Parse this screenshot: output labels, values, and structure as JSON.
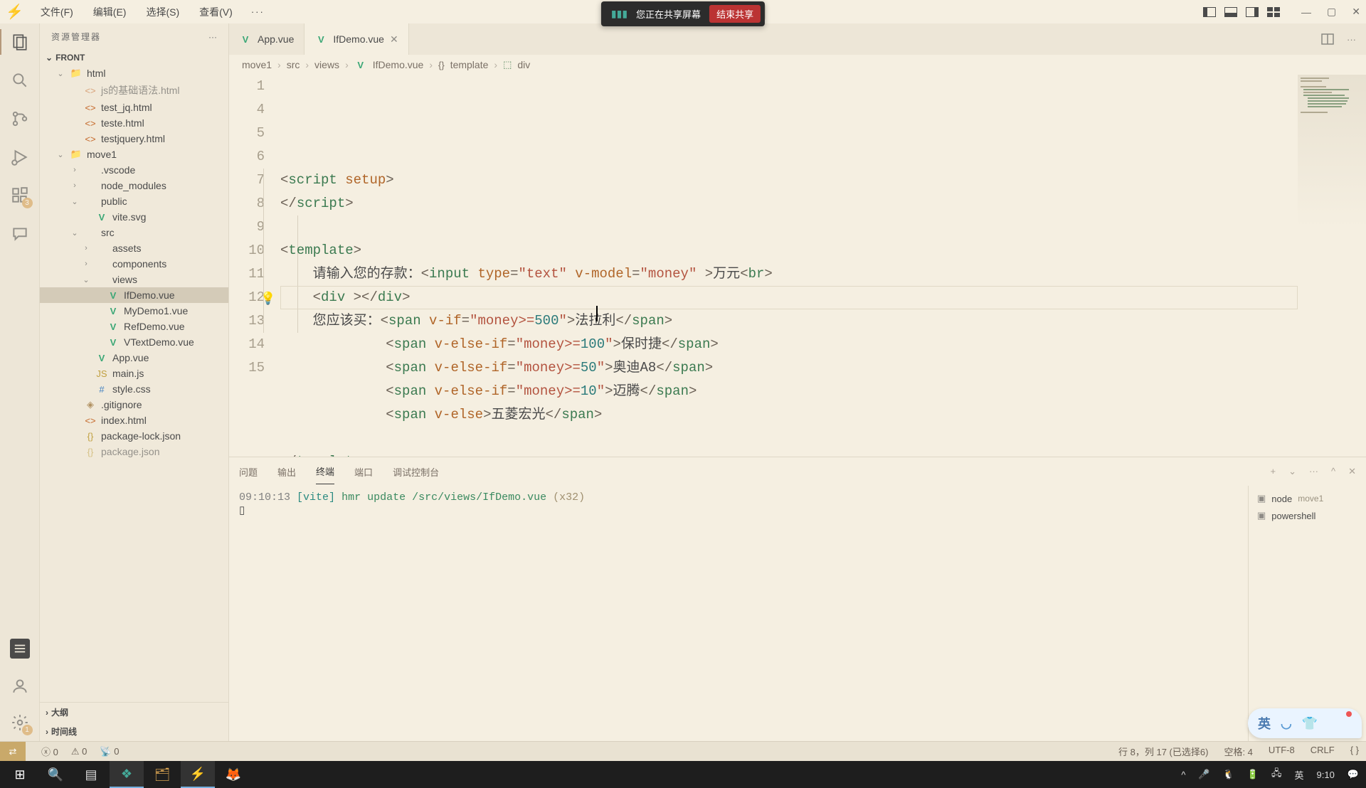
{
  "menu": {
    "file": "文件(F)",
    "edit": "编辑(E)",
    "select": "选择(S)",
    "view": "查看(V)",
    "more": "···"
  },
  "share_banner": {
    "text": "您正在共享屏幕",
    "stop": "结束共享"
  },
  "explorer": {
    "title": "资源管理器",
    "more": "···",
    "project": "FRONT"
  },
  "tree": [
    {
      "pad": 22,
      "chev": "⌄",
      "icon": "📁",
      "cls": "folder",
      "label": "html"
    },
    {
      "pad": 42,
      "icon": "<>",
      "cls": "html",
      "label": "js的基础语法.html",
      "dim": true
    },
    {
      "pad": 42,
      "icon": "<>",
      "cls": "html",
      "label": "test_jq.html"
    },
    {
      "pad": 42,
      "icon": "<>",
      "cls": "html",
      "label": "teste.html"
    },
    {
      "pad": 42,
      "icon": "<>",
      "cls": "html",
      "label": "testjquery.html"
    },
    {
      "pad": 22,
      "chev": "⌄",
      "icon": "📁",
      "cls": "folder",
      "label": "move1"
    },
    {
      "pad": 42,
      "chev": "›",
      "icon": "",
      "cls": "folder",
      "label": ".vscode"
    },
    {
      "pad": 42,
      "chev": "›",
      "icon": "",
      "cls": "folder",
      "label": "node_modules"
    },
    {
      "pad": 42,
      "chev": "⌄",
      "icon": "",
      "cls": "folder",
      "label": "public"
    },
    {
      "pad": 58,
      "icon": "V",
      "cls": "vue",
      "label": "vite.svg"
    },
    {
      "pad": 42,
      "chev": "⌄",
      "icon": "",
      "cls": "folder",
      "label": "src"
    },
    {
      "pad": 58,
      "chev": "›",
      "icon": "",
      "cls": "folder",
      "label": "assets"
    },
    {
      "pad": 58,
      "chev": "›",
      "icon": "",
      "cls": "folder",
      "label": "components"
    },
    {
      "pad": 58,
      "chev": "⌄",
      "icon": "",
      "cls": "folder",
      "label": "views"
    },
    {
      "pad": 74,
      "icon": "V",
      "cls": "vue",
      "label": "IfDemo.vue",
      "selected": true
    },
    {
      "pad": 74,
      "icon": "V",
      "cls": "vue",
      "label": "MyDemo1.vue"
    },
    {
      "pad": 74,
      "icon": "V",
      "cls": "vue",
      "label": "RefDemo.vue"
    },
    {
      "pad": 74,
      "icon": "V",
      "cls": "vue",
      "label": "VTextDemo.vue"
    },
    {
      "pad": 58,
      "icon": "V",
      "cls": "vue",
      "label": "App.vue"
    },
    {
      "pad": 58,
      "icon": "JS",
      "cls": "js",
      "label": "main.js"
    },
    {
      "pad": 58,
      "icon": "#",
      "cls": "css",
      "label": "style.css"
    },
    {
      "pad": 42,
      "icon": "◈",
      "cls": "folder",
      "label": ".gitignore"
    },
    {
      "pad": 42,
      "icon": "<>",
      "cls": "html",
      "label": "index.html"
    },
    {
      "pad": 42,
      "icon": "{}",
      "cls": "json",
      "label": "package-lock.json"
    },
    {
      "pad": 42,
      "icon": "{}",
      "cls": "json",
      "label": "package.json",
      "dim": true
    }
  ],
  "sidebar_sections": {
    "outline": "大纲",
    "timeline": "时间线"
  },
  "tabs": [
    {
      "label": "App.vue",
      "active": false
    },
    {
      "label": "IfDemo.vue",
      "active": true
    }
  ],
  "breadcrumbs": [
    "move1",
    "src",
    "views",
    "IfDemo.vue",
    "template",
    "div"
  ],
  "code": {
    "lines": [
      {
        "n": 1,
        "html": "<span class='tok-punct'>&lt;</span><span class='tok-tag'>script</span> <span class='tok-attr'>setup</span><span class='tok-punct'>&gt;</span>"
      },
      {
        "n": 4,
        "html": "<span class='tok-punct'>&lt;/</span><span class='tok-tag'>script</span><span class='tok-punct'>&gt;</span>"
      },
      {
        "n": 5,
        "html": ""
      },
      {
        "n": 6,
        "html": "<span class='tok-punct'>&lt;</span><span class='tok-tag'>template</span><span class='tok-punct'>&gt;</span>"
      },
      {
        "n": 7,
        "html": "    <span class='tok-text'>请输入您的存款：</span><span class='tok-punct'>&lt;</span><span class='tok-tag'>input</span> <span class='tok-attr'>type</span><span class='tok-punct'>=</span><span class='tok-str'>\"text\"</span> <span class='tok-attr'>v-model</span><span class='tok-punct'>=</span><span class='tok-str'>\"money\"</span> <span class='tok-punct'>&gt;</span><span class='tok-text'>万元</span><span class='tok-punct'>&lt;</span><span class='tok-tag'>br</span><span class='tok-punct'>&gt;</span>"
      },
      {
        "n": 8,
        "html": "    <span class='tok-punct'>&lt;</span><span class='tok-tag'>div</span> <span class='tok-punct'>&gt;&lt;/</span><span class='tok-tag'>div</span><span class='tok-punct'>&gt;</span>",
        "bulb": true,
        "current": true
      },
      {
        "n": 9,
        "html": "    <span class='tok-text'>您应该买：</span><span class='tok-punct'>&lt;</span><span class='tok-tag'>span</span> <span class='tok-attr'>v-if</span><span class='tok-punct'>=</span><span class='tok-str'>\"money&gt;=<span class='tok-num'>500</span>\"</span><span class='tok-punct'>&gt;</span><span class='tok-text'>法拉利</span><span class='tok-punct'>&lt;/</span><span class='tok-tag'>span</span><span class='tok-punct'>&gt;</span>"
      },
      {
        "n": 10,
        "html": "             <span class='tok-punct'>&lt;</span><span class='tok-tag'>span</span> <span class='tok-attr'>v-else-if</span><span class='tok-punct'>=</span><span class='tok-str'>\"money&gt;=<span class='tok-num'>100</span>\"</span><span class='tok-punct'>&gt;</span><span class='tok-text'>保时捷</span><span class='tok-punct'>&lt;/</span><span class='tok-tag'>span</span><span class='tok-punct'>&gt;</span>"
      },
      {
        "n": 11,
        "html": "             <span class='tok-punct'>&lt;</span><span class='tok-tag'>span</span> <span class='tok-attr'>v-else-if</span><span class='tok-punct'>=</span><span class='tok-str'>\"money&gt;=<span class='tok-num'>50</span>\"</span><span class='tok-punct'>&gt;</span><span class='tok-text'>奥迪A8</span><span class='tok-punct'>&lt;/</span><span class='tok-tag'>span</span><span class='tok-punct'>&gt;</span>"
      },
      {
        "n": 12,
        "html": "             <span class='tok-punct'>&lt;</span><span class='tok-tag'>span</span> <span class='tok-attr'>v-else-if</span><span class='tok-punct'>=</span><span class='tok-str'>\"money&gt;=<span class='tok-num'>10</span>\"</span><span class='tok-punct'>&gt;</span><span class='tok-text'>迈腾</span><span class='tok-punct'>&lt;/</span><span class='tok-tag'>span</span><span class='tok-punct'>&gt;</span>"
      },
      {
        "n": 13,
        "html": "             <span class='tok-punct'>&lt;</span><span class='tok-tag'>span</span> <span class='tok-attr'>v-else</span><span class='tok-punct'>&gt;</span><span class='tok-text'>五菱宏光</span><span class='tok-punct'>&lt;/</span><span class='tok-tag'>span</span><span class='tok-punct'>&gt;</span>"
      },
      {
        "n": 14,
        "html": ""
      },
      {
        "n": 15,
        "html": "<span class='tok-punct'>&lt;/</span><span class='tok-tag'>template</span><span class='tok-punct'>&gt;</span>"
      }
    ]
  },
  "panel": {
    "tabs": {
      "problems": "问题",
      "output": "输出",
      "terminal": "终端",
      "ports": "端口",
      "debug": "调试控制台"
    },
    "terminal_line": {
      "time": "09:10:13",
      "vite": "[vite]",
      "msg": "hmr update /src/views/IfDemo.vue",
      "count": "(x32)"
    },
    "cursor": "▯",
    "sidebar": [
      {
        "icon": "▢",
        "label": "node",
        "sub": "move1"
      },
      {
        "icon": "▢",
        "label": "powershell"
      }
    ]
  },
  "statusbar": {
    "errors": "0",
    "warnings": "0",
    "radio": "0",
    "cursor": "行 8，列 17 (已选择6)",
    "spaces": "空格: 4",
    "encoding": "UTF-8",
    "eol": "CRLF",
    "lang": "{ }"
  },
  "taskbar": {
    "ime": "英",
    "time": "9:10"
  },
  "assistant": {
    "ime": "英"
  },
  "activity_badges": {
    "ext": "3",
    "gear": "1"
  }
}
